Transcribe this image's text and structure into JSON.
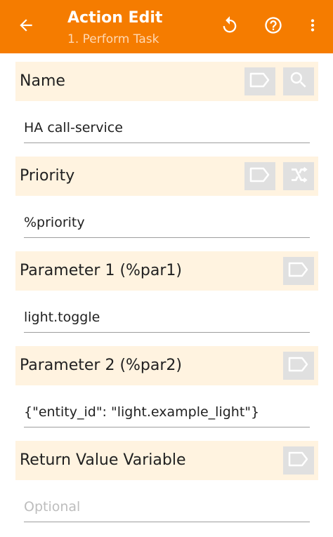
{
  "appbar": {
    "title": "Action Edit",
    "subtitle": "1. Perform Task",
    "back_icon": "arrow-left-icon",
    "undo_icon": "undo-icon",
    "help_icon": "help-circle-icon",
    "more_icon": "more-vertical-icon"
  },
  "colors": {
    "appbar_bg": "#F57C00",
    "section_bg": "#FFF3E0",
    "button_bg": "#E0E0E0",
    "subtitle": "#FFD9B3"
  },
  "sections": [
    {
      "label": "Name",
      "value": "HA call-service",
      "placeholder": "",
      "buttons": [
        "label-tag-icon",
        "search-icon"
      ]
    },
    {
      "label": "Priority",
      "value": "%priority",
      "placeholder": "",
      "buttons": [
        "label-tag-icon",
        "variable-crossed-icon"
      ]
    },
    {
      "label": "Parameter 1 (%par1)",
      "value": "light.toggle",
      "placeholder": "",
      "buttons": [
        "label-tag-icon"
      ]
    },
    {
      "label": "Parameter 2 (%par2)",
      "value": "{\"entity_id\": \"light.example_light\"}",
      "placeholder": "",
      "buttons": [
        "label-tag-icon"
      ]
    },
    {
      "label": "Return Value Variable",
      "value": "",
      "placeholder": "Optional",
      "buttons": [
        "label-tag-icon"
      ]
    }
  ]
}
